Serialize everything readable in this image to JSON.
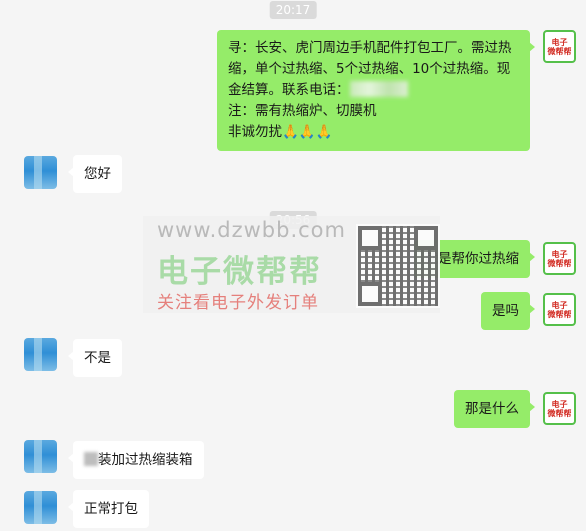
{
  "timestamps": [
    "20:17",
    "20:56"
  ],
  "messages": {
    "m1": {
      "line1": "寻：长安、虎门周边手机配件打包工厂。需过热",
      "line2": "缩，单个过热缩、5个过热缩、10个过热缩。现",
      "line3": "金结算。联系电话：",
      "line4": "注：需有热缩炉、切膜机",
      "line5": "非诚勿扰",
      "emoji": "🙏🙏🙏"
    },
    "m2": "您好",
    "m3": "就是帮你过热缩",
    "m4": "是吗",
    "m5": "不是",
    "m6": "那是什么",
    "m7": "装加过热缩装箱",
    "m8": "正常打包"
  },
  "avatar_self": {
    "line1": "电子",
    "line2": "微帮帮"
  },
  "watermark": {
    "url": "www.dzwbb.com",
    "title": "电子微帮帮",
    "subtitle": "关注看电子外发订单"
  },
  "colors": {
    "my_bubble": "#95ec69",
    "their_bubble": "#ffffff",
    "background": "#f5f5f5"
  }
}
